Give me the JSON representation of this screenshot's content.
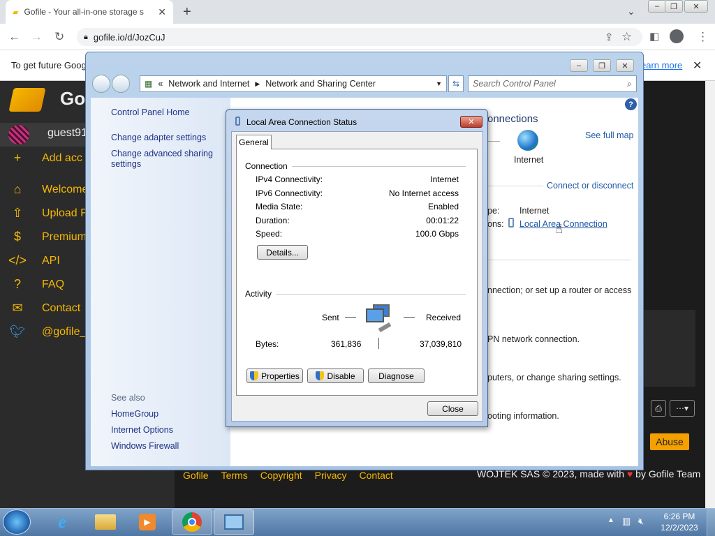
{
  "browser": {
    "tab_title": "Gofile - Your all-in-one storage s",
    "url": "gofile.io/d/JozCuJ",
    "infobar_text": "To get future Goog",
    "infobar_link": "earn more"
  },
  "gofile": {
    "brand": "Go",
    "user": "guest91",
    "add_account": "Add acc",
    "nav": [
      {
        "label": "Welcome",
        "icon": "home-icon"
      },
      {
        "label": "Upload F",
        "icon": "upload-icon"
      },
      {
        "label": "Premium",
        "icon": "dollar-icon"
      },
      {
        "label": "API",
        "icon": "code-icon"
      },
      {
        "label": "FAQ",
        "icon": "question-icon"
      },
      {
        "label": "Contact",
        "icon": "mail-icon"
      },
      {
        "label": "@gofile_",
        "icon": "twitter-icon"
      }
    ],
    "footer_links": [
      "Gofile",
      "Terms",
      "Copyright",
      "Privacy",
      "Contact"
    ],
    "footer_right_prefix": "WOJTEK SAS © 2023, made with",
    "footer_right_suffix": "by Gofile Team",
    "abuse_label": "Abuse"
  },
  "control_panel": {
    "breadcrumb_root": "«",
    "breadcrumb": [
      "Network and Internet",
      "Network and Sharing Center"
    ],
    "search_placeholder": "Search Control Panel",
    "left_links": [
      "Control Panel Home",
      "Change adapter settings",
      "Change advanced sharing settings"
    ],
    "see_also_label": "See also",
    "see_also": [
      "HomeGroup",
      "Internet Options",
      "Windows Firewall"
    ],
    "right": {
      "heading_fragment": "onnections",
      "see_full_map": "See full map",
      "internet_label": "Internet",
      "connect_disconnect": "Connect or disconnect",
      "access_type_label": "pe:",
      "access_type_value": "Internet",
      "connections_label": "ons:",
      "connection_link": "Local Area Connection",
      "task1": "nnection; or set up a router or access",
      "task2": "PN network connection.",
      "task3": "puters, or change sharing settings.",
      "task4": "ooting information."
    }
  },
  "dialog": {
    "title": "Local Area Connection Status",
    "tab": "General",
    "connection_label": "Connection",
    "rows": [
      {
        "label": "IPv4 Connectivity:",
        "value": "Internet"
      },
      {
        "label": "IPv6 Connectivity:",
        "value": "No Internet access"
      },
      {
        "label": "Media State:",
        "value": "Enabled"
      },
      {
        "label": "Duration:",
        "value": "00:01:22"
      },
      {
        "label": "Speed:",
        "value": "100.0 Gbps"
      }
    ],
    "details_button": "Details...",
    "activity_label": "Activity",
    "sent_label": "Sent",
    "received_label": "Received",
    "bytes_label": "Bytes:",
    "bytes_sent": "361,836",
    "bytes_received": "37,039,810",
    "properties_button": "Properties",
    "disable_button": "Disable",
    "diagnose_button": "Diagnose",
    "close_button": "Close"
  },
  "taskbar": {
    "time": "6:26 PM",
    "date": "12/2/2023"
  }
}
